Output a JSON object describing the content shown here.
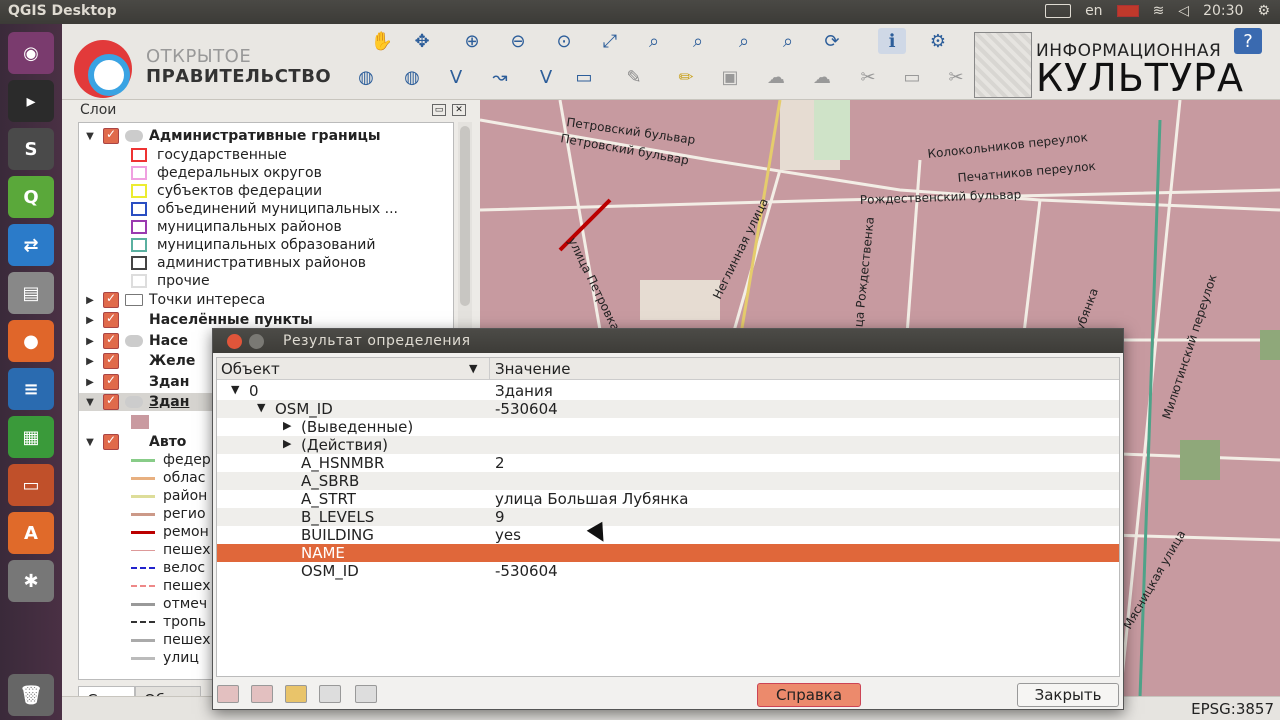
{
  "system": {
    "app_title": "QGIS Desktop",
    "lang": "en",
    "time": "20:30"
  },
  "branding": {
    "gov_line1": "ОТКРЫТОЕ",
    "gov_line2": "ПРАВИТЕЛЬСТВО",
    "culture_line1": "ИНФОРМАЦИОННАЯ",
    "culture_line2": "КУЛЬТУРА"
  },
  "layers_panel": {
    "title": "Слои",
    "groups": [
      {
        "label": "Административные границы",
        "bold": true,
        "expanded": true
      },
      {
        "label": "Точки интереса",
        "bold": false,
        "expanded": false
      },
      {
        "label": "Населённые пункты",
        "bold": true,
        "expanded": false
      },
      {
        "label": "Насе",
        "bold": true,
        "expanded": false
      },
      {
        "label": "Желе",
        "bold": true,
        "expanded": false
      },
      {
        "label": "Здан",
        "bold": true,
        "expanded": false
      },
      {
        "label": "Здан",
        "bold": true,
        "expanded": true
      },
      {
        "label": "Авто",
        "bold": true,
        "expanded": true
      }
    ],
    "admin_children": [
      "государственные",
      "федеральных округов",
      "субъектов федерации",
      "объединений муниципальных ...",
      "муниципальных районов",
      "муниципальных образований",
      "административных  районов",
      "прочие"
    ],
    "auto_children": [
      "федер",
      "облас",
      "район",
      "регио",
      "ремон",
      "пешех",
      "велос",
      "пешех",
      "отмеч",
      "тропь",
      "пешех",
      "улиц"
    ],
    "tabs": [
      "Слои",
      "Обзор"
    ]
  },
  "map_labels": [
    "Петровский бульвар",
    "Петровский бульвар",
    "Колокольников переулок",
    "Печатников переулок",
    "Рождественский бульвар",
    "Неглинная улица",
    "улица Петровка",
    "улица Рождественка",
    "Милютинский переулок",
    "Мясницкая улица",
    "Лубянка"
  ],
  "status": {
    "epsg": "EPSG:3857"
  },
  "identify_dialog": {
    "title": "Результат определения",
    "col_object": "Объект",
    "col_value": "Значение",
    "rows": [
      {
        "key": "0",
        "value": "Здания",
        "indent": 1,
        "tri": "▼"
      },
      {
        "key": "OSM_ID",
        "value": "-530604",
        "indent": 2,
        "tri": "▼"
      },
      {
        "key": "(Выведенные)",
        "value": "",
        "indent": 3,
        "tri": "▶"
      },
      {
        "key": "(Действия)",
        "value": "",
        "indent": 3,
        "tri": "▶"
      },
      {
        "key": "A_HSNMBR",
        "value": "2",
        "indent": 3,
        "tri": ""
      },
      {
        "key": "A_SBRB",
        "value": "",
        "indent": 3,
        "tri": ""
      },
      {
        "key": "A_STRT",
        "value": "улица Большая Лубянка",
        "indent": 3,
        "tri": ""
      },
      {
        "key": "B_LEVELS",
        "value": "9",
        "indent": 3,
        "tri": ""
      },
      {
        "key": "BUILDING",
        "value": "yes",
        "indent": 3,
        "tri": ""
      },
      {
        "key": "NAME",
        "value": "",
        "indent": 3,
        "tri": "",
        "selected": true
      },
      {
        "key": "OSM_ID",
        "value": "-530604",
        "indent": 3,
        "tri": ""
      }
    ],
    "help_label": "Справка",
    "close_label": "Закрыть"
  },
  "colors": {
    "accent": "#e0673a",
    "map_building": "#c99aa0"
  }
}
